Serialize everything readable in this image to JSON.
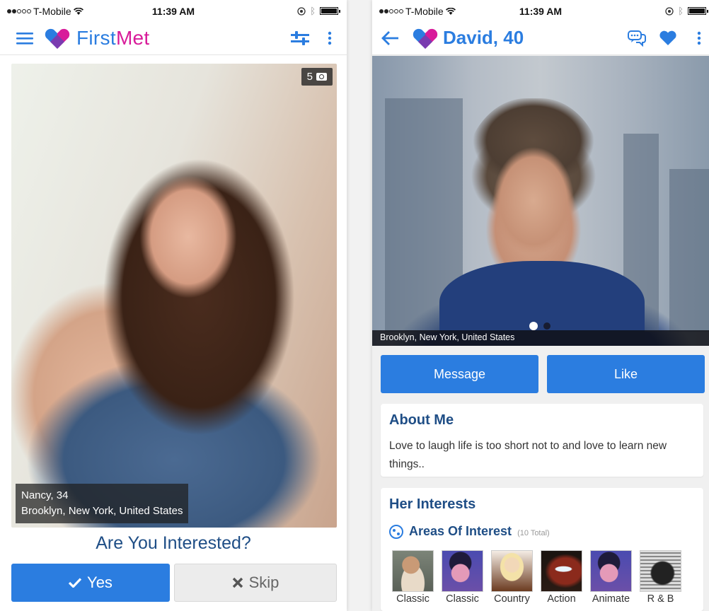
{
  "status_bar": {
    "carrier": "T-Mobile",
    "time": "11:39 AM",
    "signal_bars_filled": 2,
    "signal_bars_total": 5
  },
  "colors": {
    "brand_blue": "#2b7de0",
    "brand_magenta": "#d81b9a",
    "heading_navy": "#1f4e86"
  },
  "left_screen": {
    "navbar": {
      "menu_icon": "hamburger-menu-icon",
      "logo_icon": "heart-logo-icon",
      "brand_first": "First",
      "brand_met": "Met",
      "filter_icon": "sliders-filter-icon",
      "more_icon": "more-vertical-icon"
    },
    "profile_card": {
      "photo_count": "5",
      "photo_count_icon": "camera-icon",
      "name_age": "Nancy, 34",
      "location": "Brooklyn, New York, United States"
    },
    "question": "Are You Interested?",
    "yes_button": {
      "label": "Yes",
      "icon": "checkmark-icon"
    },
    "skip_button": {
      "label": "Skip",
      "icon": "close-x-icon"
    }
  },
  "right_screen": {
    "navbar": {
      "back_icon": "back-arrow-icon",
      "logo_icon": "heart-logo-icon",
      "title": "David, 40",
      "chat_icon": "chat-bubbles-icon",
      "favorite_icon": "heart-icon",
      "more_icon": "more-vertical-icon"
    },
    "hero": {
      "location": "Brooklyn, New York, United States",
      "pager_current": 1,
      "pager_total": 2
    },
    "message_button": "Message",
    "like_button": "Like",
    "about": {
      "heading": "About Me",
      "text": "Love to laugh life is too short not to and love to learn new things.."
    },
    "interests": {
      "heading": "Her Interests",
      "area_label": "Areas Of Interest",
      "area_total": "(10 Total)",
      "items": [
        {
          "label": "Classic"
        },
        {
          "label": "Classic"
        },
        {
          "label": "Country"
        },
        {
          "label": "Action"
        },
        {
          "label": "Animate"
        },
        {
          "label": "R & B"
        }
      ]
    }
  }
}
